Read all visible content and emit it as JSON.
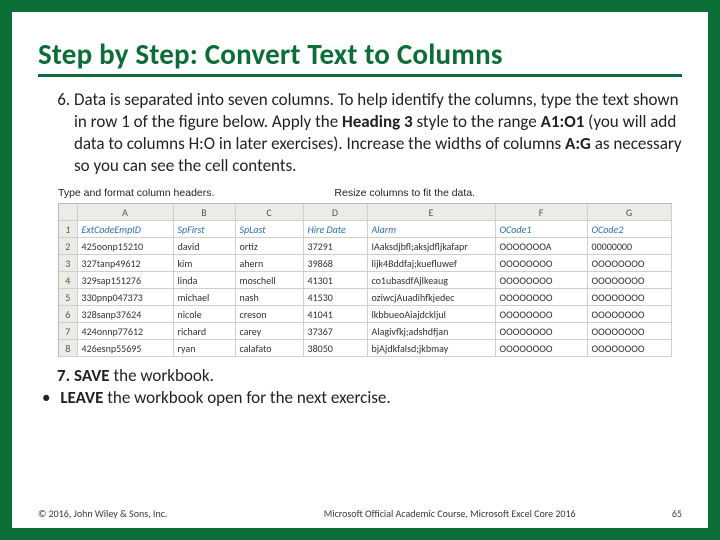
{
  "title": "Step by Step: Convert Text to Columns",
  "step6": {
    "t1": "Data is separated into seven columns. To help identify the columns, type the text shown in row 1 of the figure below. Apply the ",
    "b1": "Heading 3",
    "t2": " style to the range ",
    "b2": "A1:O1",
    "t3": " (you will add data to columns H:O in later exercises). Increase the widths of columns ",
    "b3": "A:G",
    "t4": " as necessary so you can see the cell contents."
  },
  "captions": {
    "left": "Type and format column headers.",
    "right": "Resize columns to fit the data."
  },
  "fig": {
    "cols": [
      "",
      "A",
      "B",
      "C",
      "D",
      "E",
      "F",
      "G"
    ],
    "headers": [
      "1",
      "ExtCodeEmpID",
      "SpFirst",
      "SpLast",
      "Hire Date",
      "Alarm",
      "OCode1",
      "OCode2"
    ],
    "rows": [
      [
        "2",
        "425oonp15210",
        "david",
        "ortiz",
        "37291",
        "IAaksdjbfl;aksjdfljkafapr",
        "OOOOOOOA",
        "00000000"
      ],
      [
        "3",
        "327tanp49612",
        "kim",
        "ahern",
        "39868",
        "lijk4Bddfaj;kuefluwef",
        "OOOOOOOO",
        "OOOOOOOO"
      ],
      [
        "4",
        "329sap151276",
        "linda",
        "moschell",
        "41301",
        "co1ubasdfAjlkeaug",
        "OOOOOOOO",
        "OOOOOOOO"
      ],
      [
        "5",
        "330pnp047373",
        "michael",
        "nash",
        "41530",
        "oziwcjAuadihfkjedec",
        "OOOOOOOO",
        "OOOOOOOO"
      ],
      [
        "6",
        "328sanp37624",
        "nicole",
        "creson",
        "41041",
        "lkbbueoAiajdckljul",
        "OOOOOOOO",
        "OOOOOOOO"
      ],
      [
        "7",
        "424onnp77612",
        "richard",
        "carey",
        "37367",
        "Alagivfkj;adshdfjan",
        "OOOOOOOO",
        "OOOOOOOO"
      ],
      [
        "8",
        "426esnp55695",
        "ryan",
        "calafato",
        "38050",
        "bjAjdkfalsd;jkbmay",
        "OOOOOOOO",
        "OOOOOOOO"
      ]
    ]
  },
  "step7": {
    "b1": "SAVE",
    "t1": " the workbook."
  },
  "leave": {
    "b1": "LEAVE",
    "t1": " the workbook open for the next exercise."
  },
  "footer": {
    "left": "© 2016, John Wiley & Sons, Inc.",
    "mid": "Microsoft Official Academic Course, Microsoft Excel Core 2016",
    "right": "65"
  }
}
